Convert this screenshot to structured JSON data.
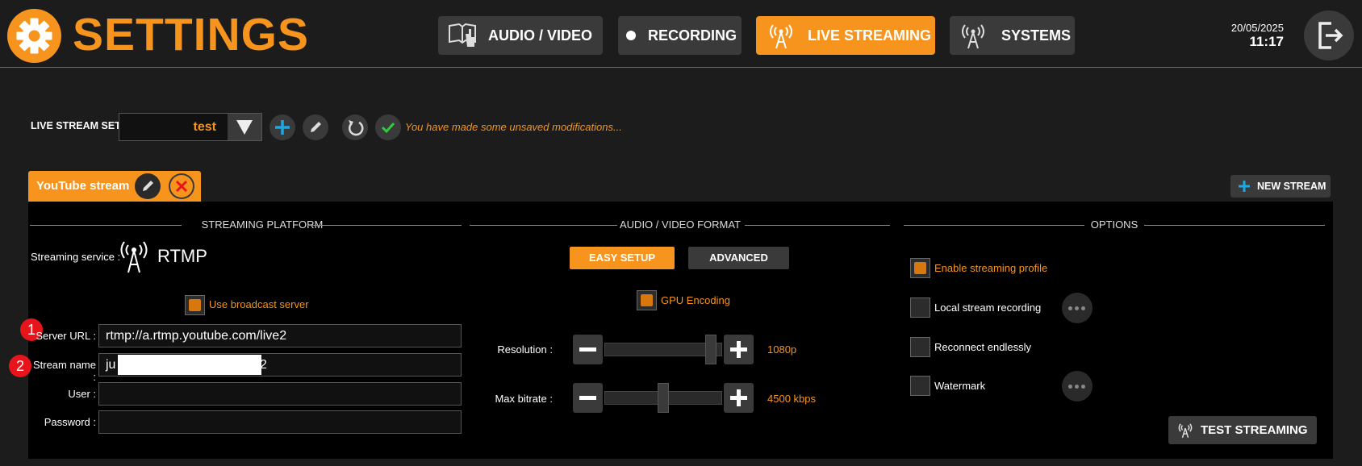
{
  "header": {
    "title": "SETTINGS",
    "tabs": [
      {
        "label": "AUDIO / VIDEO",
        "icon": "book-hand-icon"
      },
      {
        "label": "RECORDING",
        "icon": "dot-icon"
      },
      {
        "label": "LIVE STREAMING",
        "icon": "antenna-icon"
      },
      {
        "label": "SYSTEMS",
        "icon": "antenna-icon"
      }
    ],
    "active_tab": "LIVE STREAMING",
    "date": "20/05/2025",
    "time": "11:17"
  },
  "toolbar": {
    "set_label": "LIVE STREAM SET",
    "set_value": "test",
    "unsaved_message": "You have made some unsaved modifications..."
  },
  "stream_tab": {
    "label": "YouTube stream"
  },
  "new_stream_label": "NEW STREAM",
  "sections": {
    "platform": "STREAMING PLATFORM",
    "format": "AUDIO / VIDEO FORMAT",
    "options": "OPTIONS"
  },
  "platform": {
    "service_label": "Streaming service :",
    "service_value": "RTMP",
    "broadcast_label": "Use broadcast server",
    "broadcast_checked": true,
    "fields": [
      {
        "label": "Server URL :",
        "value": "rtmp://a.rtmp.youtube.com/live2"
      },
      {
        "label": "Stream name :",
        "value_start": "ju",
        "value_end": "2"
      },
      {
        "label": "User :",
        "value": ""
      },
      {
        "label": "Password :",
        "value": ""
      }
    ],
    "markers": [
      "1",
      "2"
    ]
  },
  "format": {
    "easy_label": "EASY SETUP",
    "advanced_label": "ADVANCED",
    "gpu_label": "GPU Encoding",
    "gpu_checked": true,
    "resolution_label": "Resolution :",
    "resolution_value": "1080p",
    "resolution_level": 0.95,
    "bitrate_label": "Max bitrate :",
    "bitrate_value": "4500 kbps",
    "bitrate_level": 0.5
  },
  "options": {
    "items": [
      {
        "label": "Enable streaming profile",
        "checked": true
      },
      {
        "label": "Local stream recording",
        "checked": false
      },
      {
        "label": "Reconnect endlessly",
        "checked": false
      },
      {
        "label": "Watermark",
        "checked": false
      }
    ],
    "test_label": "TEST STREAMING"
  },
  "colors": {
    "accent": "#f7941d",
    "plus": "#1ea7e1",
    "check": "#2ecc40",
    "close": "#e8141c"
  }
}
